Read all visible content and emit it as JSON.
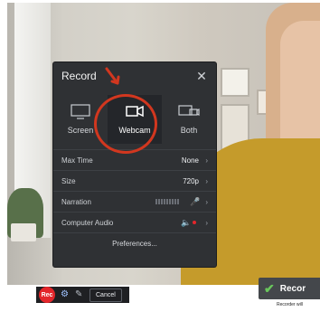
{
  "modal": {
    "title": "Record",
    "sources": [
      {
        "label": "Screen",
        "icon": "monitor-icon"
      },
      {
        "label": "Webcam",
        "icon": "webcam-icon",
        "selected": true
      },
      {
        "label": "Both",
        "icon": "screen-webcam-icon"
      }
    ],
    "settings": [
      {
        "label": "Max Time",
        "value": "None"
      },
      {
        "label": "Size",
        "value": "720p"
      },
      {
        "label": "Narration",
        "value": ""
      },
      {
        "label": "Computer Audio",
        "value": ""
      }
    ],
    "preferences_label": "Preferences..."
  },
  "toolbar": {
    "rec_label": "Rec",
    "cancel_label": "Cancel"
  },
  "toast": {
    "title": "Recor",
    "subtitle": "Recorder will"
  },
  "colors": {
    "modal_bg": "#2f3134",
    "selected_bg": "#24262a",
    "annotation_red": "#d2371f",
    "rec_red": "#e3262b",
    "success_green": "#69c65c"
  }
}
